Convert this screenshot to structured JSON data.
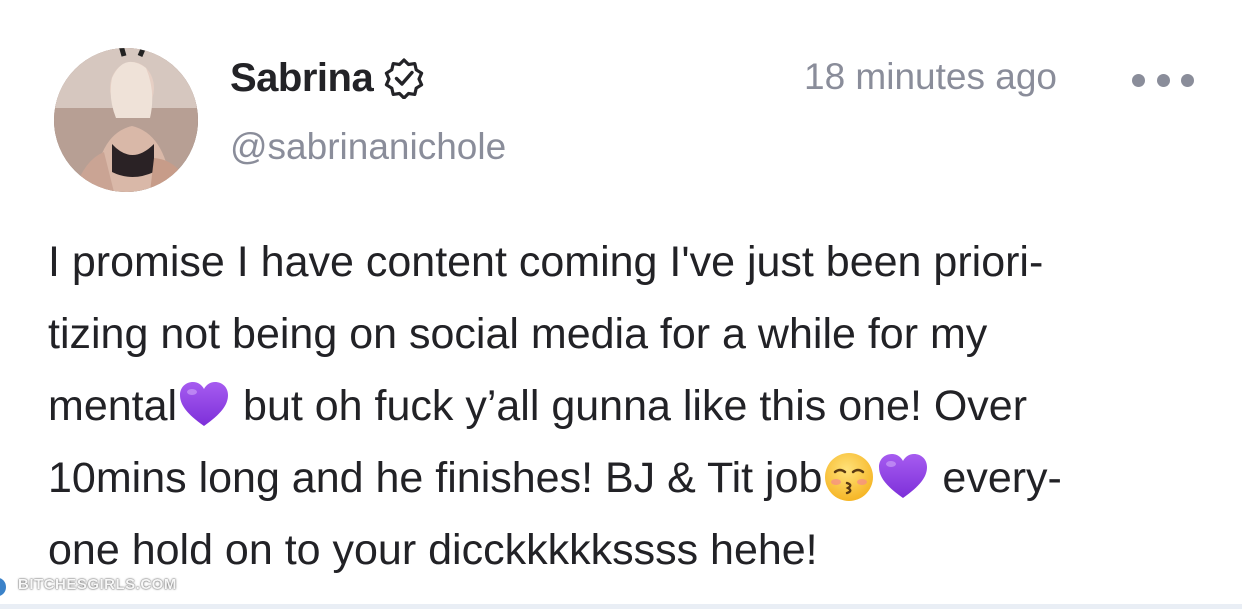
{
  "post": {
    "author_name": "Sabrina",
    "handle": "@sabrinanichole",
    "timestamp": "18 minutes ago",
    "verified": true,
    "text_lines": [
      [
        "I promise I have content coming I've just been priori-"
      ],
      [
        "tizing not being on social media for a while for my"
      ],
      [
        "mental",
        " but oh fuck y’all gunna like this one! Over"
      ],
      [
        "10mins long and he finishes! BJ & Tit job",
        " every-"
      ],
      [
        "one hold on to your dicckkkkkssss hehe!"
      ]
    ],
    "emojis": {
      "purple_heart": "purple-heart-icon",
      "kissing_face": "kissing-face-closed-eyes-icon"
    }
  },
  "watermark": "BITCHESGIRLS.COM",
  "colors": {
    "muted_text": "#8a8d9a",
    "body_text": "#222226",
    "purple_heart": "#8e3de6"
  }
}
